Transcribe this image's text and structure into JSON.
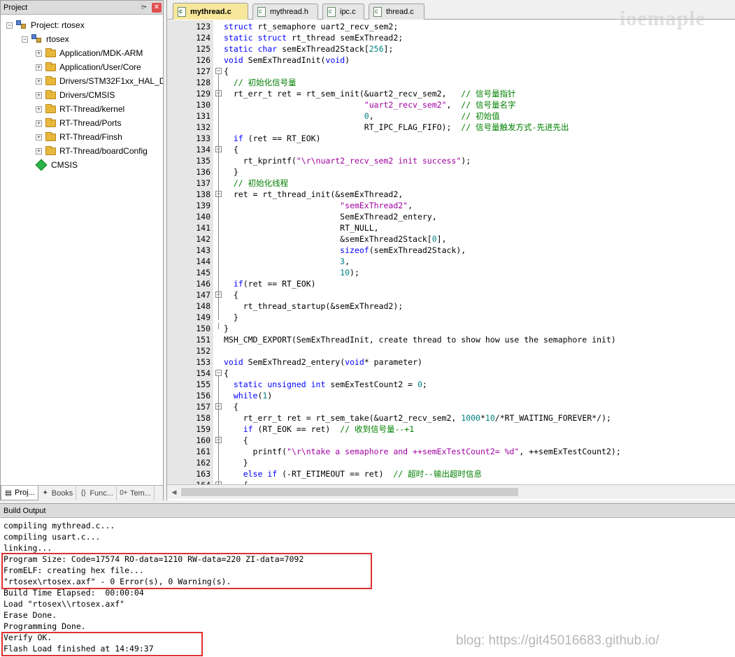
{
  "project_panel": {
    "title": "Project",
    "pin_icon": "pin-icon",
    "close_icon": "close-icon",
    "tree": [
      {
        "label": "Project: rtosex",
        "level": 0,
        "icon": "project-icon",
        "expander": "−"
      },
      {
        "label": "rtosex",
        "level": 1,
        "icon": "target-icon",
        "expander": "−"
      },
      {
        "label": "Application/MDK-ARM",
        "level": 2,
        "icon": "folder-icon",
        "expander": "+"
      },
      {
        "label": "Application/User/Core",
        "level": 2,
        "icon": "folder-icon",
        "expander": "+"
      },
      {
        "label": "Drivers/STM32F1xx_HAL_Dr",
        "level": 2,
        "icon": "folder-icon",
        "expander": "+"
      },
      {
        "label": "Drivers/CMSIS",
        "level": 2,
        "icon": "folder-icon",
        "expander": "+"
      },
      {
        "label": "RT-Thread/kernel",
        "level": 2,
        "icon": "folder-icon",
        "expander": "+"
      },
      {
        "label": "RT-Thread/Ports",
        "level": 2,
        "icon": "folder-icon",
        "expander": "+"
      },
      {
        "label": "RT-Thread/Finsh",
        "level": 2,
        "icon": "folder-icon",
        "expander": "+"
      },
      {
        "label": "RT-Thread/boardConfig",
        "level": 2,
        "icon": "folder-icon",
        "expander": "+"
      },
      {
        "label": "CMSIS",
        "level": 2,
        "icon": "green-diamond-icon",
        "expander": ""
      }
    ],
    "bottom_tabs": [
      {
        "label": "Proj...",
        "icon": "project-tab-icon",
        "active": true
      },
      {
        "label": "Books",
        "icon": "books-icon",
        "active": false
      },
      {
        "label": "Func...",
        "icon": "{}",
        "active": false
      },
      {
        "label": "Tem...",
        "icon": "0+",
        "active": false
      }
    ]
  },
  "editor": {
    "tabs": [
      {
        "label": "mythread.c",
        "active": true
      },
      {
        "label": "mythread.h",
        "active": false
      },
      {
        "label": "ipc.c",
        "active": false
      },
      {
        "label": "thread.c",
        "active": false
      }
    ],
    "lines": [
      {
        "n": 123,
        "fold": "",
        "segs": [
          [
            "kw",
            "struct"
          ],
          [
            "",
            "rt_semaphore uart2_recv_sem2;"
          ]
        ]
      },
      {
        "n": 124,
        "fold": "",
        "segs": [
          [
            "kw",
            "static struct"
          ],
          [
            "",
            "rt_thread semExThread2;"
          ]
        ]
      },
      {
        "n": 125,
        "fold": "",
        "segs": [
          [
            "kw",
            "static char"
          ],
          [
            "",
            "semExThread2Stack["
          ],
          [
            "nm",
            "256"
          ],
          [
            "",
            "];"
          ]
        ]
      },
      {
        "n": 126,
        "fold": "",
        "segs": [
          [
            "kw",
            "void"
          ],
          [
            "",
            "SemExThreadInit("
          ],
          [
            "kw",
            "void"
          ],
          [
            "",
            ")"
          ]
        ]
      },
      {
        "n": 127,
        "fold": "−",
        "segs": [
          [
            "",
            "{"
          ]
        ]
      },
      {
        "n": 128,
        "fold": "",
        "segs": [
          [
            "",
            "  "
          ],
          [
            "cm",
            "// 初始化信号量"
          ]
        ]
      },
      {
        "n": 129,
        "fold": "−",
        "segs": [
          [
            "",
            "  rt_err_t ret = rt_sem_init(&uart2_recv_sem2,   "
          ],
          [
            "cm",
            "// 信号量指针"
          ]
        ]
      },
      {
        "n": 130,
        "fold": "",
        "segs": [
          [
            "",
            "                             "
          ],
          [
            "st",
            "\"uart2_recv_sem2\""
          ],
          [
            "",
            ",  "
          ],
          [
            "cm",
            "// 信号量名字"
          ]
        ]
      },
      {
        "n": 131,
        "fold": "",
        "segs": [
          [
            "",
            "                             "
          ],
          [
            "nm",
            "0"
          ],
          [
            "",
            ",                  "
          ],
          [
            "cm",
            "// 初始值"
          ]
        ]
      },
      {
        "n": 132,
        "fold": "",
        "segs": [
          [
            "",
            "                             RT_IPC_FLAG_FIFO);  "
          ],
          [
            "cm",
            "// 信号量触发方式-先进先出"
          ]
        ]
      },
      {
        "n": 133,
        "fold": "",
        "segs": [
          [
            "",
            "  "
          ],
          [
            "kw",
            "if"
          ],
          [
            "",
            " (ret == RT_EOK)"
          ]
        ]
      },
      {
        "n": 134,
        "fold": "−",
        "segs": [
          [
            "",
            "  {"
          ]
        ]
      },
      {
        "n": 135,
        "fold": "",
        "segs": [
          [
            "",
            "    rt_kprintf("
          ],
          [
            "st",
            "\"\\r\\nuart2_recv_sem2 init success\""
          ],
          [
            "",
            ");"
          ]
        ]
      },
      {
        "n": 136,
        "fold": "",
        "segs": [
          [
            "",
            "  }"
          ]
        ]
      },
      {
        "n": 137,
        "fold": "",
        "segs": [
          [
            "",
            "  "
          ],
          [
            "cm",
            "// 初始化线程"
          ]
        ]
      },
      {
        "n": 138,
        "fold": "−",
        "segs": [
          [
            "",
            "  ret = rt_thread_init(&semExThread2,"
          ]
        ]
      },
      {
        "n": 139,
        "fold": "",
        "segs": [
          [
            "",
            "                        "
          ],
          [
            "st",
            "\"semExThread2\""
          ],
          [
            "",
            ","
          ]
        ]
      },
      {
        "n": 140,
        "fold": "",
        "segs": [
          [
            "",
            "                        SemExThread2_entery,"
          ]
        ]
      },
      {
        "n": 141,
        "fold": "",
        "segs": [
          [
            "",
            "                        RT_NULL,"
          ]
        ]
      },
      {
        "n": 142,
        "fold": "",
        "segs": [
          [
            "",
            "                        &semExThread2Stack["
          ],
          [
            "nm",
            "0"
          ],
          [
            "",
            "],"
          ]
        ]
      },
      {
        "n": 143,
        "fold": "",
        "segs": [
          [
            "",
            "                        "
          ],
          [
            "kw",
            "sizeof"
          ],
          [
            "",
            "(semExThread2Stack),"
          ]
        ]
      },
      {
        "n": 144,
        "fold": "",
        "segs": [
          [
            "",
            "                        "
          ],
          [
            "nm",
            "3"
          ],
          [
            "",
            ","
          ]
        ]
      },
      {
        "n": 145,
        "fold": "",
        "segs": [
          [
            "",
            "                        "
          ],
          [
            "nm",
            "10"
          ],
          [
            "",
            ");"
          ]
        ]
      },
      {
        "n": 146,
        "fold": "",
        "segs": [
          [
            "",
            "  "
          ],
          [
            "kw",
            "if"
          ],
          [
            "",
            "(ret == RT_EOK)"
          ]
        ]
      },
      {
        "n": 147,
        "fold": "−",
        "segs": [
          [
            "",
            "  {"
          ]
        ]
      },
      {
        "n": 148,
        "fold": "",
        "segs": [
          [
            "",
            "    rt_thread_startup(&semExThread2);"
          ]
        ]
      },
      {
        "n": 149,
        "fold": "",
        "segs": [
          [
            "",
            "  }"
          ]
        ]
      },
      {
        "n": 150,
        "fold": "end",
        "segs": [
          [
            "",
            "}"
          ]
        ]
      },
      {
        "n": 151,
        "fold": "",
        "segs": [
          [
            "",
            "MSH_CMD_EXPORT(SemExThreadInit, create thread to show how use the semaphore init)"
          ]
        ]
      },
      {
        "n": 152,
        "fold": "",
        "segs": [
          [
            "",
            ""
          ]
        ]
      },
      {
        "n": 153,
        "fold": "",
        "segs": [
          [
            "kw",
            "void"
          ],
          [
            "",
            "SemExThread2_entery("
          ],
          [
            "kw",
            "void"
          ],
          [
            "",
            "* parameter)"
          ]
        ]
      },
      {
        "n": 154,
        "fold": "−",
        "segs": [
          [
            "",
            "{"
          ]
        ]
      },
      {
        "n": 155,
        "fold": "",
        "segs": [
          [
            "",
            "  "
          ],
          [
            "kw",
            "static unsigned int"
          ],
          [
            "",
            "semExTestCount2 = "
          ],
          [
            "nm",
            "0"
          ],
          [
            "",
            ";"
          ]
        ]
      },
      {
        "n": 156,
        "fold": "",
        "segs": [
          [
            "",
            "  "
          ],
          [
            "kw",
            "while"
          ],
          [
            "",
            "("
          ],
          [
            "nm",
            "1"
          ],
          [
            "",
            ")"
          ]
        ]
      },
      {
        "n": 157,
        "fold": "−",
        "segs": [
          [
            "",
            "  {"
          ]
        ]
      },
      {
        "n": 158,
        "fold": "",
        "segs": [
          [
            "",
            "    rt_err_t ret = rt_sem_take(&uart2_recv_sem2, "
          ],
          [
            "nm",
            "1000"
          ],
          [
            "",
            "*"
          ],
          [
            "nm",
            "10"
          ],
          [
            "",
            "/*RT_WAITING_FOREVER*/);"
          ]
        ]
      },
      {
        "n": 159,
        "fold": "",
        "segs": [
          [
            "",
            "    "
          ],
          [
            "kw",
            "if"
          ],
          [
            "",
            " (RT_EOK == ret)  "
          ],
          [
            "cm",
            "// 收到信号量--+1"
          ]
        ]
      },
      {
        "n": 160,
        "fold": "−",
        "segs": [
          [
            "",
            "    {"
          ]
        ]
      },
      {
        "n": 161,
        "fold": "",
        "segs": [
          [
            "",
            "      printf("
          ],
          [
            "st",
            "\"\\r\\ntake a semaphore and ++semExTestCount2= %d\""
          ],
          [
            "",
            ", ++semExTestCount2);"
          ]
        ]
      },
      {
        "n": 162,
        "fold": "",
        "segs": [
          [
            "",
            "    }"
          ]
        ]
      },
      {
        "n": 163,
        "fold": "",
        "segs": [
          [
            "",
            "    "
          ],
          [
            "kw",
            "else if"
          ],
          [
            "",
            " (-RT_ETIMEOUT == ret)  "
          ],
          [
            "cm",
            "// 超时--输出超时信息"
          ]
        ]
      },
      {
        "n": 164,
        "fold": "−",
        "segs": [
          [
            "",
            "    {"
          ]
        ]
      }
    ]
  },
  "build_output": {
    "title": "Build Output",
    "lines": [
      "compiling mythread.c...",
      "compiling usart.c...",
      "linking...",
      "Program Size: Code=17574 RO-data=1210 RW-data=220 ZI-data=7092",
      "FromELF: creating hex file...",
      "\"rtosex\\rtosex.axf\" - 0 Error(s), 0 Warning(s).",
      "Build Time Elapsed:  00:00:04",
      "Load \"rtosex\\\\rtosex.axf\"",
      "Erase Done.",
      "Programming Done.",
      "Verify OK.",
      "Flash Load finished at 14:49:37"
    ],
    "highlight_color": "#e03030"
  },
  "watermarks": {
    "top_right": "ioemaple",
    "bottom": "blog: https://git45016683.github.io/"
  },
  "colors": {
    "keyword": "#0000ff",
    "comment": "#008000",
    "string": "#a000a0",
    "number": "#008080",
    "active_tab": "#f6e79a"
  }
}
